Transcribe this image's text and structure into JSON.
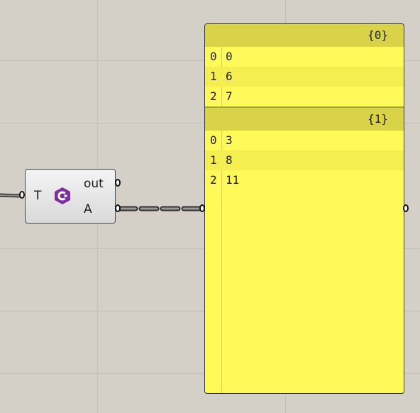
{
  "component": {
    "input_label": "T",
    "outputs": [
      {
        "label": "out"
      },
      {
        "label": "A"
      }
    ],
    "icon": "csharp-script-icon",
    "icon_color": "#7b2fa0"
  },
  "panel": {
    "background": "#fff95a",
    "branches": [
      {
        "path": "{0}",
        "rows": [
          {
            "index": "0",
            "value": "0"
          },
          {
            "index": "1",
            "value": "6"
          },
          {
            "index": "2",
            "value": "7"
          }
        ]
      },
      {
        "path": "{1}",
        "rows": [
          {
            "index": "0",
            "value": "3"
          },
          {
            "index": "1",
            "value": "8"
          },
          {
            "index": "2",
            "value": "11"
          }
        ]
      }
    ]
  }
}
